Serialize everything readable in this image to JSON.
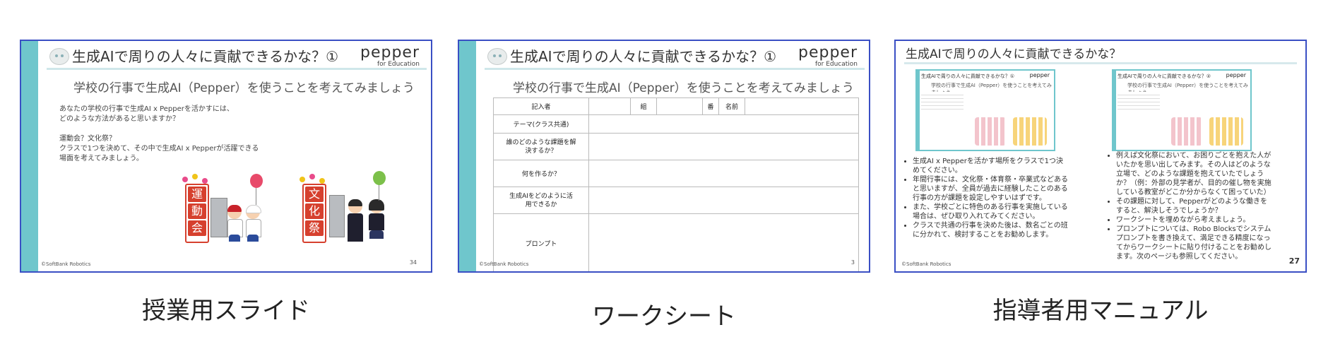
{
  "slide": {
    "title": "生成AIで周りの人々に貢献できるかな？①",
    "logo_main": "pepper",
    "logo_sub": "for Education",
    "subtitle": "学校の行事で生成AI（Pepper）を使うことを考えてみましょう",
    "body": [
      "あなたの学校の行事で生成AI x Pepperを活かすには、",
      "どのような方法があると思いますか？",
      "",
      "運動会？文化祭？",
      "クラスで1つを決めて、その中で生成AI x Pepperが活躍できる",
      "場面を考えてみましょう。"
    ],
    "banner1": [
      "運",
      "動",
      "会"
    ],
    "banner2": [
      "文",
      "化",
      "祭"
    ],
    "footer": "©SoftBank Robotics",
    "page": "34"
  },
  "worksheet": {
    "title": "生成AIで周りの人々に貢献できるかな？①",
    "logo_main": "pepper",
    "logo_sub": "for Education",
    "subtitle": "学校の行事で生成AI（Pepper）を使うことを考えてみましょう",
    "row_recorder": "記入者",
    "col_class": "組",
    "col_number": "番",
    "col_name": "名前",
    "row_theme": "テーマ(クラス共通)",
    "row_problem": "誰のどのような課題を解決するか？",
    "row_make": "何を作るか？",
    "row_use": "生成AIをどのように活用できるか",
    "row_prompt": "プロンプト",
    "footer": "©SoftBank Robotics",
    "page": "3"
  },
  "manual": {
    "title": "生成AIで周りの人々に貢献できるかな？",
    "thumb1_title": "生成AIで周りの人々に貢献できるかな？①",
    "thumb2_title": "生成AIで周りの人々に貢献できるかな？②",
    "thumb_sub": "学校の行事で生成AI（Pepper）を使うことを考えてみましょう",
    "logo_main": "pepper",
    "left_bullets": [
      "生成AI x Pepperを活かす場所をクラスで1つ決めてください。",
      "年間行事には、文化祭・体育祭・卒業式などあると思いますが、全員が過去に経験したことのある行事の方が課題を設定しやすいはずです。",
      "また、学校ごとに特色のある行事を実施している場合は、ぜひ取り入れてみてください。",
      "クラスで共通の行事を決めた後は、数名ごとの班に分かれて、検討することをお勧めします。"
    ],
    "right_bullets": [
      "例えば文化祭において、お困りごとを抱えた人がいたかを思い出してみます。その人はどのような立場で、どのような課題を抱えていたでしょうか？（例：外部の見学者が、目的の催し物を実施している教室がどこか分からなくて困っていた）",
      "その課題に対して、Pepperがどのような働きをすると、解決しそうでしょうか？",
      "ワークシートを埋めながら考えましょう。",
      "プロンプトについては、Robo Blocksでシステムプロンプトを書き換えて、満足できる精度になってからワークシートに貼り付けることをお勧めします。次のページも参照してください。"
    ],
    "footer": "©SoftBank Robotics",
    "page": "27"
  },
  "captions": {
    "slide": "授業用スライド",
    "worksheet": "ワークシート",
    "manual": "指導者用マニュアル"
  },
  "colors": {
    "frame": "#3a4fc4",
    "accent": "#6fc6cc",
    "festival_red": "#d6402e"
  }
}
